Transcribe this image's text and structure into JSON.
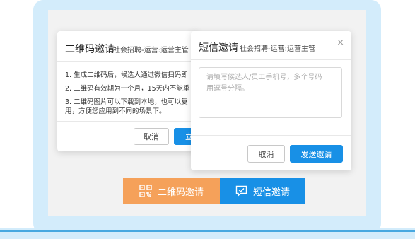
{
  "qr_dialog": {
    "title": "二维码邀请",
    "subtitle": "社会招聘-运营:运营主管",
    "lines": [
      "1. 生成二维码后，候选人通过微信扫码即",
      "2. 二维码有效期为一个月，15天内不能重",
      "3. 二维码图片可以下载到本地，也可以复",
      "用，方便您应用到不同的场景下。"
    ],
    "cancel_label": "取消",
    "confirm_label": "立"
  },
  "sms_dialog": {
    "title": "短信邀请",
    "subtitle": "社会招聘-运营:运营主管",
    "close_symbol": "×",
    "textarea_placeholder_line1": "请填写候选人/员工手机号，多个号码",
    "textarea_placeholder_line2": "用逗号分隔。",
    "cancel_label": "取消",
    "send_label": "发送邀请"
  },
  "invite_buttons": {
    "qr_label": "二维码邀请",
    "sms_label": "短信邀请"
  },
  "colors": {
    "primary_blue": "#1890e6",
    "orange": "#f5a15a",
    "device_frame": "#d3ecfb"
  },
  "icons": {
    "qr": "qr-code-icon",
    "sms": "message-check-icon"
  }
}
